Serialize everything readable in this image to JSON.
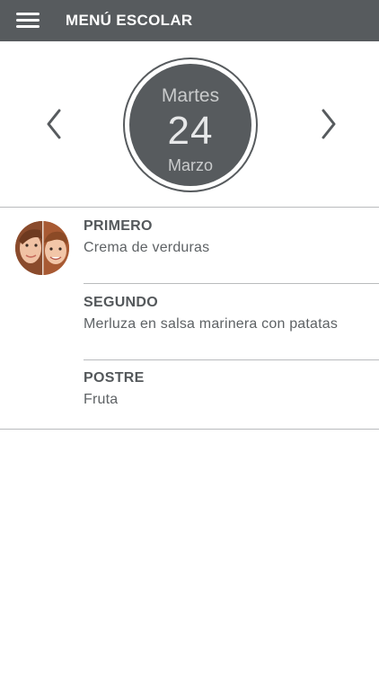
{
  "header": {
    "title": "MENÚ ESCOLAR",
    "menu_icon": "hamburger-menu-icon"
  },
  "date": {
    "weekday": "Martes",
    "day": "24",
    "month": "Marzo",
    "prev_icon": "chevron-left-icon",
    "next_icon": "chevron-right-icon"
  },
  "menu": {
    "avatar": "children-photo",
    "courses": [
      {
        "title": "PRIMERO",
        "dish": "Crema de verduras"
      },
      {
        "title": "SEGUNDO",
        "dish": "Merluza en salsa marinera con patatas"
      },
      {
        "title": "POSTRE",
        "dish": "Fruta"
      }
    ]
  },
  "colors": {
    "header_bg": "#575b5e",
    "date_circle": "#575b5e",
    "text_dark": "#54585b",
    "divider": "#b9bbbd"
  }
}
